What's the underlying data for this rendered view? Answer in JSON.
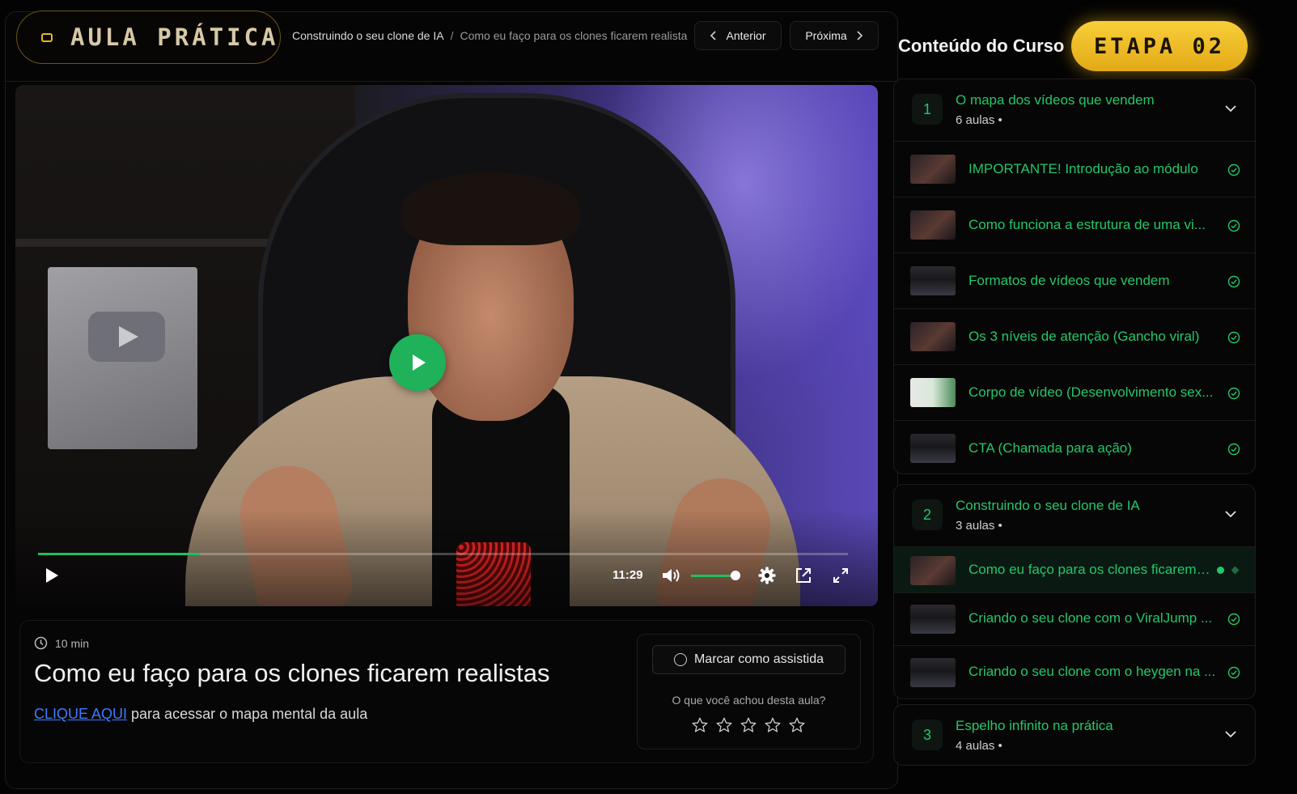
{
  "header": {
    "brand": "AULA PRÁTICA",
    "breadcrumb": [
      "Construindo o seu clone de IA",
      "Como eu faço para os clones ficarem realista"
    ],
    "breadcrumb_sep": "/",
    "prev_label": "Anterior",
    "next_label": "Próxima"
  },
  "player": {
    "time": "11:29",
    "progress_fraction": 0.2,
    "volume_fraction": 0.85
  },
  "lesson": {
    "duration": "10 min",
    "title": "Como eu faço para os clones ficarem realistas",
    "link_text": "CLIQUE AQUI",
    "link_suffix": " para acessar o mapa mental da aula",
    "mark_watched": "Marcar como assistida",
    "rating_question": "O que você achou desta aula?",
    "rating_stars": 5,
    "rating_value": 0
  },
  "sidebar": {
    "title": "Conteúdo do Curso",
    "badge": "ETAPA 02",
    "modules": [
      {
        "number": "1",
        "name": "O mapa dos vídeos que vendem",
        "count": "6 aulas •",
        "lessons": [
          {
            "title": "IMPORTANTE! Introdução ao módulo",
            "status": "done"
          },
          {
            "title": "Como funciona a estrutura de uma vi...",
            "status": "done"
          },
          {
            "title": "Formatos de vídeos que vendem",
            "status": "done"
          },
          {
            "title": "Os 3 níveis de atenção (Gancho viral)",
            "status": "done"
          },
          {
            "title": "Corpo de vídeo (Desenvolvimento sex...",
            "status": "done"
          },
          {
            "title": "CTA (Chamada para ação)",
            "status": "done"
          }
        ]
      },
      {
        "number": "2",
        "name": "Construindo o seu clone de IA",
        "count": "3 aulas •",
        "lessons": [
          {
            "title": "Como eu faço para os clones ficarem ...",
            "status": "current"
          },
          {
            "title": "Criando o seu clone com o ViralJump ...",
            "status": "done"
          },
          {
            "title": "Criando o seu clone com o heygen na ...",
            "status": "done"
          }
        ]
      },
      {
        "number": "3",
        "name": "Espelho infinito na prática",
        "count": "4 aulas •",
        "lessons": []
      }
    ]
  },
  "colors": {
    "accent_green": "#22c76a",
    "brand_gold": "#f2c230",
    "link_blue": "#3f7bff",
    "background": "#030303"
  },
  "icons": [
    "play-icon",
    "volume-icon",
    "gear-icon",
    "popout-icon",
    "fullscreen-icon",
    "clock-icon",
    "check-circle-icon",
    "chevron-down-icon",
    "chevron-left-icon",
    "chevron-right-icon",
    "star-icon"
  ]
}
